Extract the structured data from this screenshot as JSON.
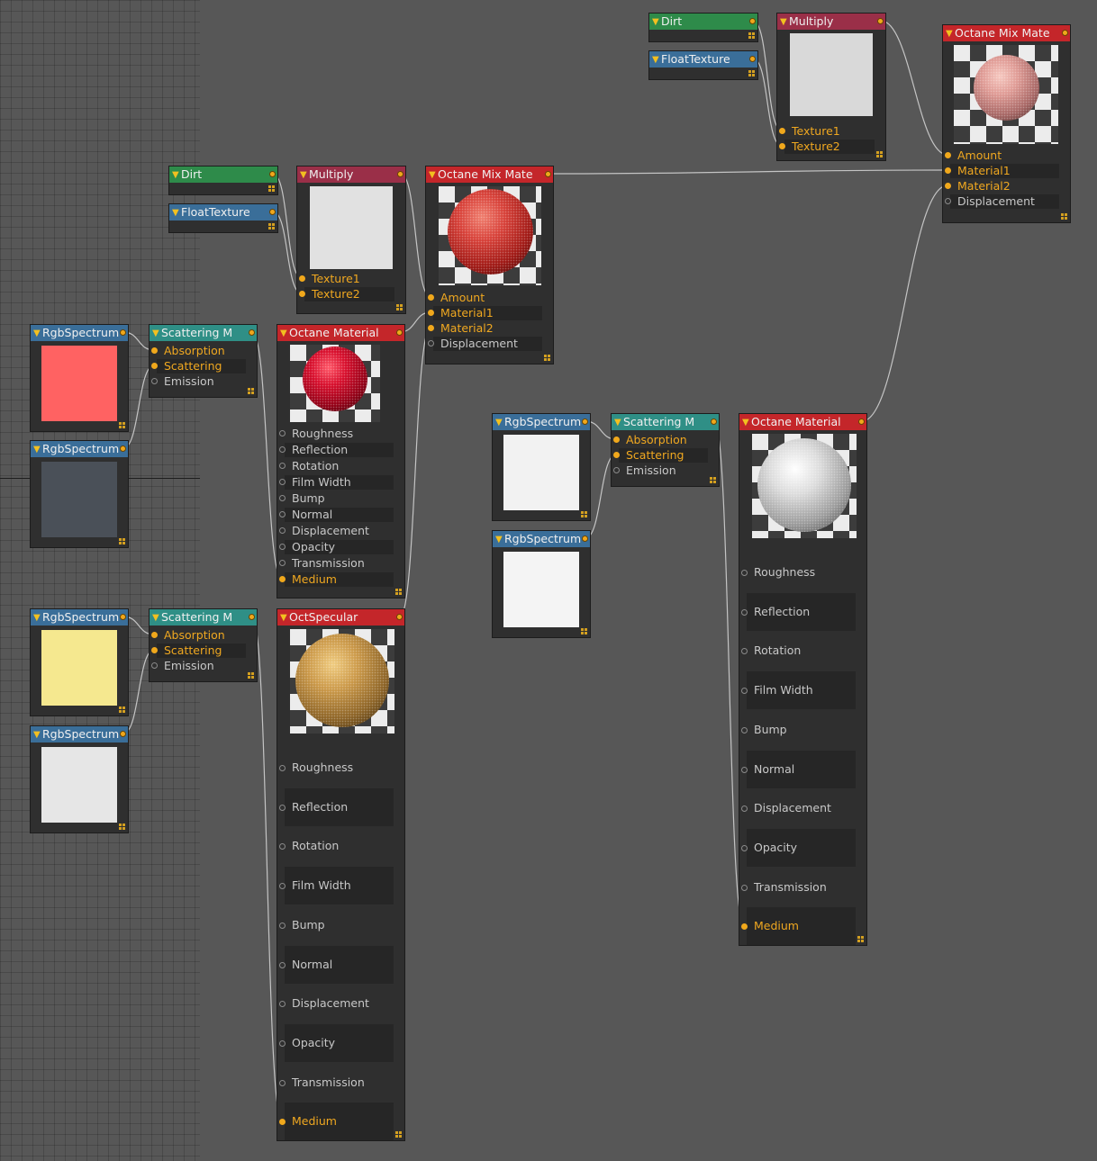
{
  "colors": {
    "canvas": "#575757",
    "node_body": "#2f2f2f",
    "active_pin": "#f0a81c",
    "wire": "#c4c4c4",
    "header_green": "#2e8b4a",
    "header_blue": "#3a6e99",
    "header_maroon": "#9a2f48",
    "header_red": "#c4262a",
    "header_teal": "#2f8f86"
  },
  "nodes": [
    {
      "id": "dirt_top",
      "type": "dirt",
      "title": "Dirt",
      "header_color": "#2e8b4a"
    },
    {
      "id": "float_top",
      "type": "float",
      "title": "FloatTexture",
      "header_color": "#3a6e99"
    },
    {
      "id": "mul_top",
      "type": "multiply",
      "title": "Multiply",
      "header_color": "#9a2f48",
      "preview_color": "#d9d9d9",
      "inputs": [
        {
          "label": "Texture1",
          "active": true
        },
        {
          "label": "Texture2",
          "active": true
        }
      ]
    },
    {
      "id": "mix_top",
      "type": "mix",
      "title": "Octane Mix Mate",
      "header_color": "#c4262a",
      "sphere": "pink",
      "inputs": [
        {
          "label": "Amount",
          "active": true
        },
        {
          "label": "Material1",
          "active": true
        },
        {
          "label": "Material2",
          "active": true
        },
        {
          "label": "Displacement",
          "active": false
        }
      ]
    },
    {
      "id": "dirt_mid",
      "type": "dirt",
      "title": "Dirt",
      "header_color": "#2e8b4a"
    },
    {
      "id": "float_mid",
      "type": "float",
      "title": "FloatTexture",
      "header_color": "#3a6e99"
    },
    {
      "id": "mul_mid",
      "type": "multiply",
      "title": "Multiply",
      "header_color": "#9a2f48",
      "preview_color": "#e1e1e1",
      "inputs": [
        {
          "label": "Texture1",
          "active": true
        },
        {
          "label": "Texture2",
          "active": true
        }
      ]
    },
    {
      "id": "mix_mid",
      "type": "mix",
      "title": "Octane Mix Mate",
      "header_color": "#c4262a",
      "sphere": "red",
      "inputs": [
        {
          "label": "Amount",
          "active": true
        },
        {
          "label": "Material1",
          "active": true
        },
        {
          "label": "Material2",
          "active": true
        },
        {
          "label": "Displacement",
          "active": false
        }
      ]
    },
    {
      "id": "rgb_a1",
      "type": "rgb",
      "title": "RgbSpectrum",
      "header_color": "#3a6e99",
      "swatch": "#ff6262"
    },
    {
      "id": "rgb_a2",
      "type": "rgb",
      "title": "RgbSpectrum",
      "header_color": "#3a6e99",
      "swatch": "#4a5058"
    },
    {
      "id": "scat_a",
      "type": "scatter",
      "title": "Scattering M",
      "header_color": "#2f8f86",
      "inputs": [
        {
          "label": "Absorption",
          "active": true
        },
        {
          "label": "Scattering",
          "active": true
        },
        {
          "label": "Emission",
          "active": false
        }
      ]
    },
    {
      "id": "mat_red",
      "type": "material",
      "title": "Octane Material",
      "header_color": "#c4262a",
      "sphere": "crimson",
      "inputs": [
        {
          "label": "Roughness",
          "active": false
        },
        {
          "label": "Reflection",
          "active": false
        },
        {
          "label": "Rotation",
          "active": false
        },
        {
          "label": "Film Width",
          "active": false
        },
        {
          "label": "Bump",
          "active": false
        },
        {
          "label": "Normal",
          "active": false
        },
        {
          "label": "Displacement",
          "active": false
        },
        {
          "label": "Opacity",
          "active": false
        },
        {
          "label": "Transmission",
          "active": false
        },
        {
          "label": "Medium",
          "active": true
        }
      ]
    },
    {
      "id": "rgb_b1",
      "type": "rgb",
      "title": "RgbSpectrum",
      "header_color": "#3a6e99",
      "swatch": "#f5e88f"
    },
    {
      "id": "rgb_b2",
      "type": "rgb",
      "title": "RgbSpectrum",
      "header_color": "#3a6e99",
      "swatch": "#e6e6e6"
    },
    {
      "id": "scat_b",
      "type": "scatter",
      "title": "Scattering M",
      "header_color": "#2f8f86",
      "inputs": [
        {
          "label": "Absorption",
          "active": true
        },
        {
          "label": "Scattering",
          "active": true
        },
        {
          "label": "Emission",
          "active": false
        }
      ]
    },
    {
      "id": "spec",
      "type": "material",
      "title": "OctSpecular",
      "header_color": "#c4262a",
      "sphere": "gold",
      "inputs": [
        {
          "label": "Roughness",
          "active": false
        },
        {
          "label": "Reflection",
          "active": false
        },
        {
          "label": "Rotation",
          "active": false
        },
        {
          "label": "Film Width",
          "active": false
        },
        {
          "label": "Bump",
          "active": false
        },
        {
          "label": "Normal",
          "active": false
        },
        {
          "label": "Displacement",
          "active": false
        },
        {
          "label": "Opacity",
          "active": false
        },
        {
          "label": "Transmission",
          "active": false
        },
        {
          "label": "Medium",
          "active": true
        }
      ]
    },
    {
      "id": "rgb_c1",
      "type": "rgb",
      "title": "RgbSpectrum",
      "header_color": "#3a6e99",
      "swatch": "#f2f2f2"
    },
    {
      "id": "rgb_c2",
      "type": "rgb",
      "title": "RgbSpectrum",
      "header_color": "#3a6e99",
      "swatch": "#f4f4f4"
    },
    {
      "id": "scat_c",
      "type": "scatter",
      "title": "Scattering M",
      "header_color": "#2f8f86",
      "inputs": [
        {
          "label": "Absorption",
          "active": true
        },
        {
          "label": "Scattering",
          "active": true
        },
        {
          "label": "Emission",
          "active": false
        }
      ]
    },
    {
      "id": "mat_white",
      "type": "material",
      "title": "Octane Material",
      "header_color": "#c4262a",
      "sphere": "white",
      "inputs": [
        {
          "label": "Roughness",
          "active": false
        },
        {
          "label": "Reflection",
          "active": false
        },
        {
          "label": "Rotation",
          "active": false
        },
        {
          "label": "Film Width",
          "active": false
        },
        {
          "label": "Bump",
          "active": false
        },
        {
          "label": "Normal",
          "active": false
        },
        {
          "label": "Displacement",
          "active": false
        },
        {
          "label": "Opacity",
          "active": false
        },
        {
          "label": "Transmission",
          "active": false
        },
        {
          "label": "Medium",
          "active": true
        }
      ]
    }
  ],
  "connections": [
    {
      "from": "dirt_top",
      "to": "mul_top",
      "input": 0
    },
    {
      "from": "float_top",
      "to": "mul_top",
      "input": 1
    },
    {
      "from": "mul_top",
      "to": "mix_top",
      "input": 0
    },
    {
      "from": "mix_mid",
      "to": "mix_top",
      "input": 1
    },
    {
      "from": "mat_white",
      "to": "mix_top",
      "input": 2
    },
    {
      "from": "dirt_mid",
      "to": "mul_mid",
      "input": 0
    },
    {
      "from": "float_mid",
      "to": "mul_mid",
      "input": 1
    },
    {
      "from": "mul_mid",
      "to": "mix_mid",
      "input": 0
    },
    {
      "from": "mat_red",
      "to": "mix_mid",
      "input": 1
    },
    {
      "from": "spec",
      "to": "mix_mid",
      "input": 2
    },
    {
      "from": "rgb_a1",
      "to": "scat_a",
      "input": 0
    },
    {
      "from": "rgb_a2",
      "to": "scat_a",
      "input": 1
    },
    {
      "from": "scat_a",
      "to": "mat_red",
      "input": 9
    },
    {
      "from": "rgb_b1",
      "to": "scat_b",
      "input": 0
    },
    {
      "from": "rgb_b2",
      "to": "scat_b",
      "input": 1
    },
    {
      "from": "scat_b",
      "to": "spec",
      "input": 9
    },
    {
      "from": "rgb_c1",
      "to": "scat_c",
      "input": 0
    },
    {
      "from": "rgb_c2",
      "to": "scat_c",
      "input": 1
    },
    {
      "from": "scat_c",
      "to": "mat_white",
      "input": 9
    }
  ]
}
